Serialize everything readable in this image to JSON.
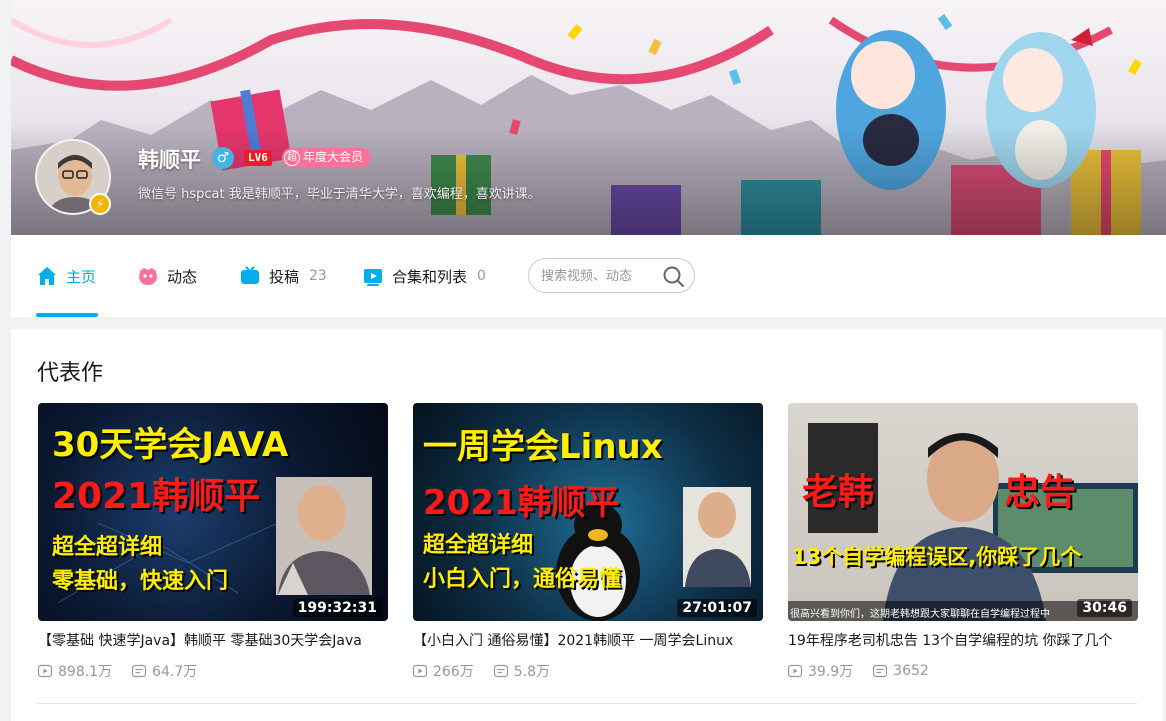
{
  "profile": {
    "name": "韩顺平",
    "level": "LV6",
    "vip_char": "超",
    "vip_label": "年度大会员",
    "sign": "微信号 hspcat 我是韩顺平，毕业于清华大学，喜欢编程，喜欢讲课。"
  },
  "nav": {
    "home": "主页",
    "dynamic": "动态",
    "uploads": "投稿",
    "uploads_count": "23",
    "collections": "合集和列表",
    "collections_count": "0",
    "search_placeholder": "搜索视频、动态"
  },
  "section": {
    "title": "代表作"
  },
  "videos": [
    {
      "title": "【零基础 快速学Java】韩顺平 零基础30天学会Java",
      "duration": "199:32:31",
      "views": "898.1万",
      "danmaku": "64.7万",
      "cover": {
        "line1": "30天学会JAVA",
        "line2": "2021韩顺平",
        "line3": "超全超详细",
        "line4": "零基础，快速入门"
      }
    },
    {
      "title": "【小白入门 通俗易懂】2021韩顺平 一周学会Linux",
      "duration": "27:01:07",
      "views": "266万",
      "danmaku": "5.8万",
      "cover": {
        "line1": "一周学会Linux",
        "line2": "2021韩顺平",
        "line3": "超全超详细",
        "line4": "小白入门，通俗易懂"
      }
    },
    {
      "title": "19年程序老司机忠告 13个自学编程的坑 你踩了几个",
      "duration": "30:46",
      "views": "39.9万",
      "danmaku": "3652",
      "cover": {
        "left": "老韩",
        "right": "忠告",
        "line": "13个自学编程误区,你踩了几个",
        "subtitle": "很高兴看到你们，这期老韩想跟大家聊聊在自学编程过程中"
      }
    }
  ],
  "colors": {
    "accent": "#00aeec",
    "vip_pink": "#fb7299",
    "level_red": "#ee1c24"
  }
}
